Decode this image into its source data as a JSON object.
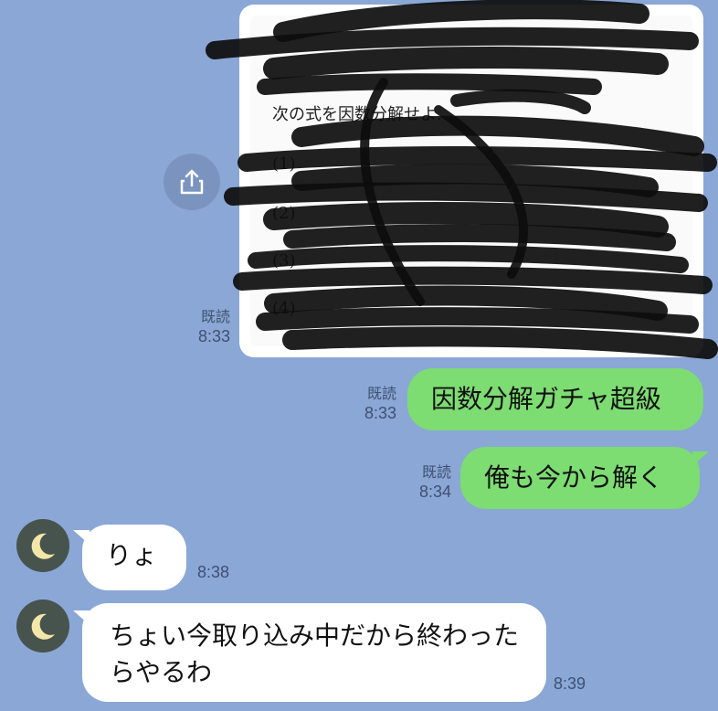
{
  "image_message": {
    "heading": "次の式を因数分解せよ.",
    "lines": [
      "(1)",
      "(2)",
      "(3)",
      "(4)"
    ]
  },
  "messages": [
    {
      "read": "既読",
      "time": "8:33"
    },
    {
      "read": "既読",
      "time": "8:33",
      "text": "因数分解ガチャ超級"
    },
    {
      "read": "既読",
      "time": "8:34",
      "text": "俺も今から解く"
    },
    {
      "time": "8:38",
      "text": "りょ"
    },
    {
      "time": "8:39",
      "text": "ちょい今取り込み中だから終わったらやるわ"
    }
  ],
  "colors": {
    "background": "#8aa7d6",
    "sent_bubble": "#7ddc72",
    "received_bubble": "#ffffff",
    "avatar_bg": "#47534d",
    "moon": "#f3e6a8"
  },
  "icons": {
    "share": "share-icon",
    "avatar": "moon-icon"
  }
}
